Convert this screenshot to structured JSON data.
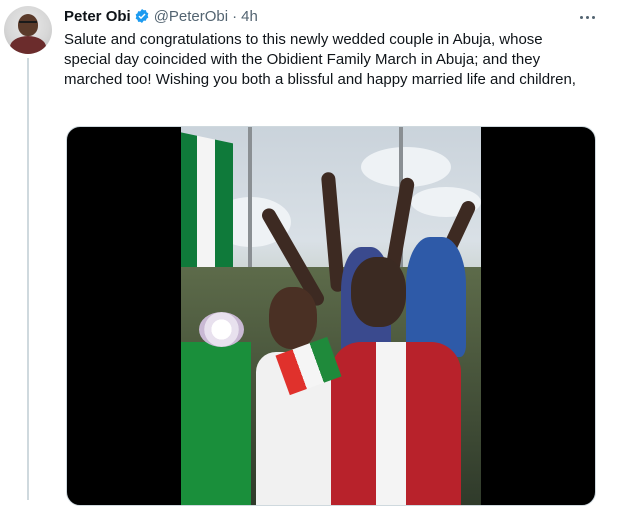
{
  "tweet": {
    "author_name": "Peter Obi",
    "handle": "@PeterObi",
    "separator": "·",
    "time": "4h",
    "text": "Salute and congratulations to this newly wedded couple in Abuja, whose special day coincided with the Obidient Family March in Abuja; and they marched too! Wishing you both a blissful and happy married life and children,"
  },
  "icons": {
    "verified": "verified-badge-icon",
    "more": "more-options-icon"
  },
  "colors": {
    "verified_blue": "#1d9bf0",
    "secondary_text": "#536471",
    "primary_text": "#0f1419"
  }
}
